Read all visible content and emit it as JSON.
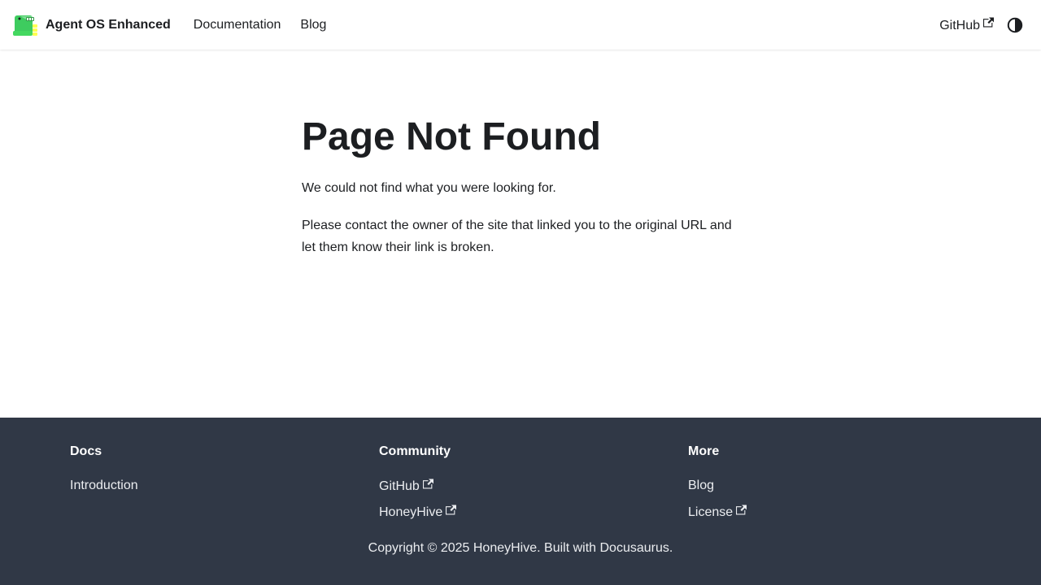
{
  "navbar": {
    "brand_title": "Agent OS Enhanced",
    "links": [
      "Documentation",
      "Blog"
    ],
    "github_label": "GitHub"
  },
  "main": {
    "title": "Page Not Found",
    "paragraph1": "We could not find what you were looking for.",
    "paragraph2": "Please contact the owner of the site that linked you to the original URL and let them know their link is broken."
  },
  "footer": {
    "columns": [
      {
        "title": "Docs",
        "items": [
          "Introduction"
        ]
      },
      {
        "title": "Community",
        "items": [
          "GitHub",
          "HoneyHive"
        ]
      },
      {
        "title": "More",
        "items": [
          "Blog",
          "License"
        ]
      }
    ],
    "copyright": "Copyright © 2025 HoneyHive. Built with Docusaurus."
  },
  "colors": {
    "footer_bg": "#303846",
    "text": "#1c1e21",
    "logo_green": "#3ecc5f"
  },
  "icons": [
    "dinosaur-logo",
    "external-link-icon",
    "theme-toggle-icon"
  ]
}
